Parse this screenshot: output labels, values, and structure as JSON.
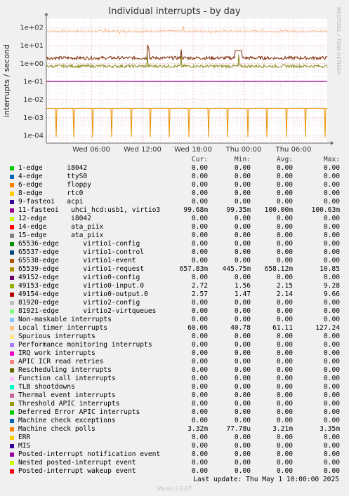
{
  "title": "Individual interrupts - by day",
  "side_label": "RRDTOOL / TOBI OETIKER",
  "footer_last_update": "Last update: Thu May  1 10:00:00 2025",
  "footer_version": "Munin 2.0.67",
  "headers": {
    "cur": "Cur:",
    "min": "Min:",
    "avg": "Avg:",
    "max": "Max:"
  },
  "chart_data": {
    "type": "line",
    "title": "Individual interrupts - by day",
    "ylabel": "interrupts / second",
    "yscale": "log",
    "ylim": [
      5e-05,
      200
    ],
    "y_ticks": [
      "1e-04",
      "1e-03",
      "1e-02",
      "1e-01",
      "1e+00",
      "1e+01",
      "1e+02"
    ],
    "x_ticks": [
      "Wed 06:00",
      "Wed 12:00",
      "Wed 18:00",
      "Thu 00:00",
      "Thu 06:00"
    ],
    "grid": true,
    "series_shown": [
      {
        "name": "Local timer interrupts",
        "color": "#f8b78a",
        "approx_value": 61
      },
      {
        "name": "virtio1-request",
        "color": "#7c2c08",
        "approx_value": 2.0
      },
      {
        "name": "virtio0-input.0",
        "color": "#8c8c1c",
        "approx_value": 0.7
      },
      {
        "name": "11-fasteoi uhci_hcd:usb1, virtio3",
        "color": "#8c008c",
        "approx_value": 0.1
      },
      {
        "name": "Machine check polls",
        "color": "#ea8f00",
        "approx_value": 0.0032,
        "dips_to": 8e-05
      }
    ]
  },
  "legend": [
    {
      "color": "#00cc00",
      "label": "1-edge      i8042",
      "cur": "0.00",
      "min": "0.00",
      "avg": "0.00",
      "max": "0.00"
    },
    {
      "color": "#0066b3",
      "label": "4-edge      ttyS0",
      "cur": "0.00",
      "min": "0.00",
      "avg": "0.00",
      "max": "0.00"
    },
    {
      "color": "#ff8000",
      "label": "6-edge      floppy",
      "cur": "0.00",
      "min": "0.00",
      "avg": "0.00",
      "max": "0.00"
    },
    {
      "color": "#ffcc00",
      "label": "8-edge      rtc0",
      "cur": "0.00",
      "min": "0.00",
      "avg": "0.00",
      "max": "0.00"
    },
    {
      "color": "#330099",
      "label": "9-fasteoi   acpi",
      "cur": "0.00",
      "min": "0.00",
      "avg": "0.00",
      "max": "0.00"
    },
    {
      "color": "#990099",
      "label": "11-fasteoi   uhci_hcd:usb1, virtio3",
      "cur": "99.68m",
      "min": "99.35m",
      "avg": "100.00m",
      "max": "100.63m"
    },
    {
      "color": "#ccff00",
      "label": "12-edge      i8042",
      "cur": "0.00",
      "min": "0.00",
      "avg": "0.00",
      "max": "0.00"
    },
    {
      "color": "#ff0000",
      "label": "14-edge      ata_piix",
      "cur": "0.00",
      "min": "0.00",
      "avg": "0.00",
      "max": "0.00"
    },
    {
      "color": "#808080",
      "label": "15-edge      ata_piix",
      "cur": "0.00",
      "min": "0.00",
      "avg": "0.00",
      "max": "0.00"
    },
    {
      "color": "#008f00",
      "label": "65536-edge      virtio1-config",
      "cur": "0.00",
      "min": "0.00",
      "avg": "0.00",
      "max": "0.00"
    },
    {
      "color": "#00487d",
      "label": "65537-edge      virtio1-control",
      "cur": "0.00",
      "min": "0.00",
      "avg": "0.00",
      "max": "0.00"
    },
    {
      "color": "#b35a00",
      "label": "65538-edge      virtio1-event",
      "cur": "0.00",
      "min": "0.00",
      "avg": "0.00",
      "max": "0.00"
    },
    {
      "color": "#b38f00",
      "label": "65539-edge      virtio1-request",
      "cur": "657.83m",
      "min": "445.75m",
      "avg": "658.12m",
      "max": "10.85"
    },
    {
      "color": "#6b006b",
      "label": "49152-edge      virtio0-config",
      "cur": "0.00",
      "min": "0.00",
      "avg": "0.00",
      "max": "0.00"
    },
    {
      "color": "#8fb300",
      "label": "49153-edge      virtio0-input.0",
      "cur": "2.72",
      "min": "1.56",
      "avg": "2.15",
      "max": "9.28"
    },
    {
      "color": "#b30000",
      "label": "49154-edge      virtio0-output.0",
      "cur": "2.57",
      "min": "1.47",
      "avg": "2.14",
      "max": "9.66"
    },
    {
      "color": "#bebebe",
      "label": "81920-edge      virtio2-config",
      "cur": "0.00",
      "min": "0.00",
      "avg": "0.00",
      "max": "0.00"
    },
    {
      "color": "#80ff80",
      "label": "81921-edge      virtio2-virtqueues",
      "cur": "0.00",
      "min": "0.00",
      "avg": "0.00",
      "max": "0.00"
    },
    {
      "color": "#80c9ff",
      "label": "Non-maskable interrupts",
      "cur": "0.00",
      "min": "0.00",
      "avg": "0.00",
      "max": "0.00"
    },
    {
      "color": "#ffc080",
      "label": "Local timer interrupts",
      "cur": "60.06",
      "min": "40.78",
      "avg": "61.11",
      "max": "127.24"
    },
    {
      "color": "#ffe680",
      "label": "Spurious interrupts",
      "cur": "0.00",
      "min": "0.00",
      "avg": "0.00",
      "max": "0.00"
    },
    {
      "color": "#aa80ff",
      "label": "Performance monitoring interrupts",
      "cur": "0.00",
      "min": "0.00",
      "avg": "0.00",
      "max": "0.00"
    },
    {
      "color": "#ee00cc",
      "label": "IRQ work interrupts",
      "cur": "0.00",
      "min": "0.00",
      "avg": "0.00",
      "max": "0.00"
    },
    {
      "color": "#ff8080",
      "label": "APIC ICR read retries",
      "cur": "0.00",
      "min": "0.00",
      "avg": "0.00",
      "max": "0.00"
    },
    {
      "color": "#666600",
      "label": "Rescheduling interrupts",
      "cur": "0.00",
      "min": "0.00",
      "avg": "0.00",
      "max": "0.00"
    },
    {
      "color": "#ffbfff",
      "label": "Function call interrupts",
      "cur": "0.00",
      "min": "0.00",
      "avg": "0.00",
      "max": "0.00"
    },
    {
      "color": "#00ffcc",
      "label": "TLB shootdowns",
      "cur": "0.00",
      "min": "0.00",
      "avg": "0.00",
      "max": "0.00"
    },
    {
      "color": "#cc6699",
      "label": "Thermal event interrupts",
      "cur": "0.00",
      "min": "0.00",
      "avg": "0.00",
      "max": "0.00"
    },
    {
      "color": "#999900",
      "label": "Threshold APIC interrupts",
      "cur": "0.00",
      "min": "0.00",
      "avg": "0.00",
      "max": "0.00"
    },
    {
      "color": "#00cc00",
      "label": "Deferred Error APIC interrupts",
      "cur": "0.00",
      "min": "0.00",
      "avg": "0.00",
      "max": "0.00"
    },
    {
      "color": "#0066b3",
      "label": "Machine check exceptions",
      "cur": "0.00",
      "min": "0.00",
      "avg": "0.00",
      "max": "0.00"
    },
    {
      "color": "#ff8000",
      "label": "Machine check polls",
      "cur": "3.32m",
      "min": "77.78u",
      "avg": "3.21m",
      "max": "3.35m"
    },
    {
      "color": "#ffcc00",
      "label": "ERR",
      "cur": "0.00",
      "min": "0.00",
      "avg": "0.00",
      "max": "0.00"
    },
    {
      "color": "#330099",
      "label": "MIS",
      "cur": "0.00",
      "min": "0.00",
      "avg": "0.00",
      "max": "0.00"
    },
    {
      "color": "#990099",
      "label": "Posted-interrupt notification event",
      "cur": "0.00",
      "min": "0.00",
      "avg": "0.00",
      "max": "0.00"
    },
    {
      "color": "#ccff00",
      "label": "Nested posted-interrupt event",
      "cur": "0.00",
      "min": "0.00",
      "avg": "0.00",
      "max": "0.00"
    },
    {
      "color": "#ff0000",
      "label": "Posted-interrupt wakeup event",
      "cur": "0.00",
      "min": "0.00",
      "avg": "0.00",
      "max": "0.00"
    }
  ]
}
